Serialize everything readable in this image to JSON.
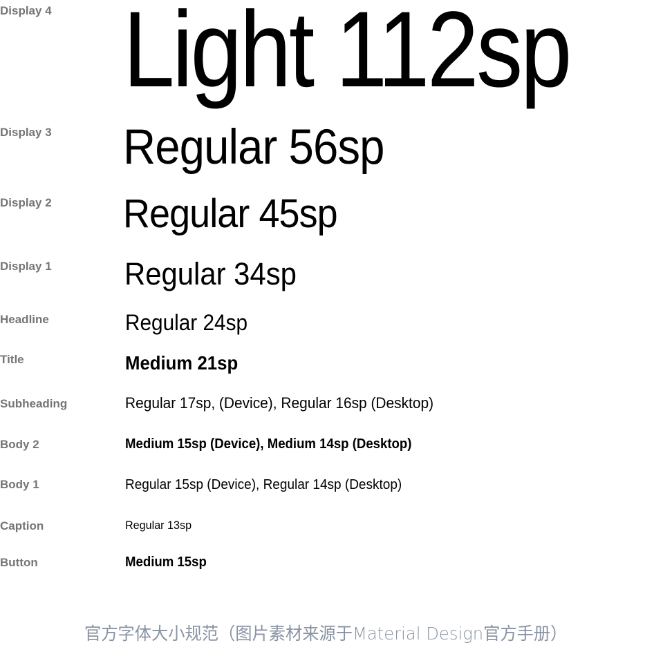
{
  "rows": [
    {
      "label": "Display 4",
      "sample": "Light 112sp"
    },
    {
      "label": "Display 3",
      "sample": "Regular 56sp"
    },
    {
      "label": "Display 2",
      "sample": "Regular 45sp"
    },
    {
      "label": "Display 1",
      "sample": "Regular 34sp"
    },
    {
      "label": "Headline",
      "sample": "Regular 24sp"
    },
    {
      "label": "Title",
      "sample": "Medium 21sp"
    },
    {
      "label": "Subheading",
      "sample": "Regular 17sp, (Device), Regular 16sp (Desktop)"
    },
    {
      "label": "Body 2",
      "sample": "Medium 15sp (Device), Medium 14sp (Desktop)"
    },
    {
      "label": "Body 1",
      "sample": "Regular 15sp (Device), Regular 14sp (Desktop)"
    },
    {
      "label": "Caption",
      "sample": "Regular 13sp"
    },
    {
      "label": "Button",
      "sample": "Medium 15sp"
    }
  ],
  "footer_caption": "官方字体大小规范（图片素材来源于Material Design官方手册）",
  "colors": {
    "label": "#757575",
    "sample": "#000000",
    "caption": "#8a93a3"
  }
}
